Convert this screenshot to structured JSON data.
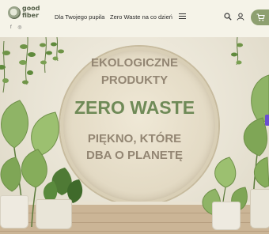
{
  "brand": {
    "line1": "good",
    "line2": "fiber"
  },
  "social": {
    "facebook_glyph": "f",
    "instagram_glyph": "◎"
  },
  "nav": [
    {
      "label": "Dla Twojego pupila"
    },
    {
      "label": "Zero Waste na co dzień"
    }
  ],
  "icons": {
    "menu": "menu-icon",
    "search": "search-icon",
    "account": "user-icon",
    "cart": "cart-icon"
  },
  "colors": {
    "accent": "#8ea070",
    "hero_green": "#6f8a57",
    "hero_brown": "#938673"
  },
  "hero": {
    "line1": "EKOLOGICZNE",
    "line2": "PRODUKTY",
    "headline": "ZERO WASTE",
    "line4": "PIĘKNO, KTÓRE",
    "line5": "DBA O PLANETĘ"
  }
}
